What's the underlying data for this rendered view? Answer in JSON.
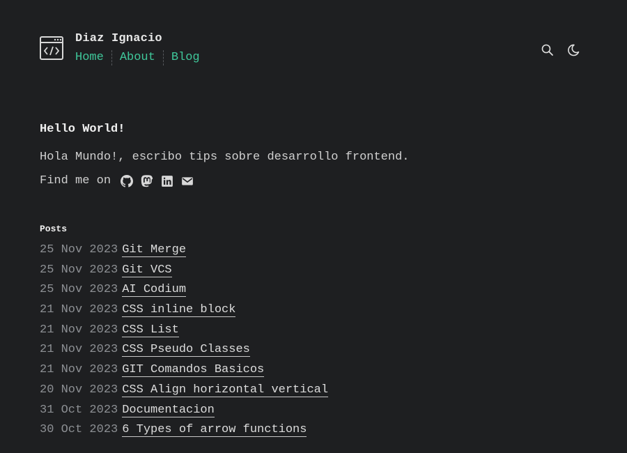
{
  "header": {
    "site_title": "Diaz Ignacio",
    "logo_icon": "code-window-icon",
    "nav": [
      {
        "label": "Home"
      },
      {
        "label": "About"
      },
      {
        "label": "Blog"
      }
    ],
    "actions": [
      {
        "icon": "search-icon"
      },
      {
        "icon": "moon-icon"
      }
    ],
    "accent_color": "#3fc79a"
  },
  "hero": {
    "heading": "Hello World!",
    "intro": "Hola Mundo!, escribo tips sobre desarrollo frontend.",
    "find_me": "Find me on",
    "social_icons": [
      "github-icon",
      "mastodon-icon",
      "linkedin-icon",
      "email-icon"
    ]
  },
  "posts": {
    "heading": "Posts",
    "items": [
      {
        "date": "25 Nov 2023",
        "title": "Git Merge"
      },
      {
        "date": "25 Nov 2023",
        "title": "Git VCS"
      },
      {
        "date": "25 Nov 2023",
        "title": "AI Codium"
      },
      {
        "date": "21 Nov 2023",
        "title": "CSS inline block"
      },
      {
        "date": "21 Nov 2023",
        "title": "CSS List"
      },
      {
        "date": "21 Nov 2023",
        "title": "CSS Pseudo Classes"
      },
      {
        "date": "21 Nov 2023",
        "title": "GIT Comandos Basicos"
      },
      {
        "date": "20 Nov 2023",
        "title": "CSS Align horizontal vertical"
      },
      {
        "date": "31 Oct 2023",
        "title": "Documentacion"
      },
      {
        "date": "30 Oct 2023",
        "title": "6 Types of arrow functions"
      }
    ]
  }
}
